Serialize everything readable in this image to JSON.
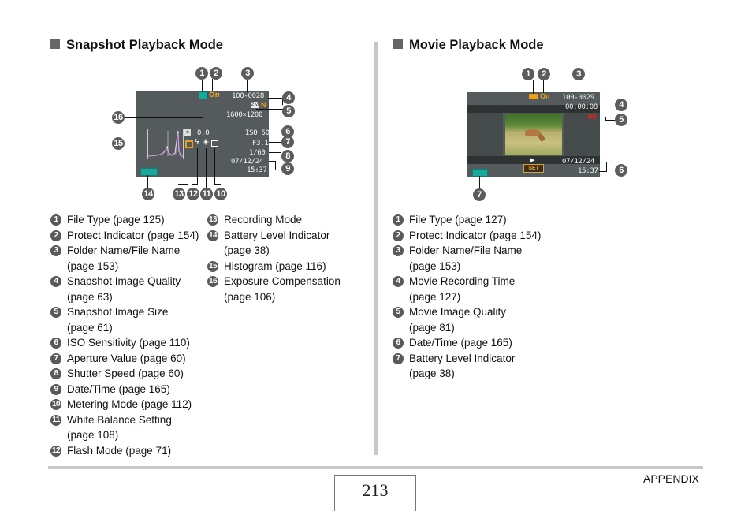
{
  "snapshot": {
    "title": "Snapshot Playback Mode",
    "screen": {
      "folder_file": "100-0028",
      "quality_icon": "N",
      "size_icon": "2M",
      "image_size": "1600×1200",
      "exposure_comp": "0.0",
      "iso": "ISO 50",
      "aperture": "F3.1",
      "shutter": "1/60",
      "date": "07/12/24",
      "time": "15:37"
    },
    "callouts": [
      "1",
      "2",
      "3",
      "4",
      "5",
      "6",
      "7",
      "8",
      "9",
      "10",
      "11",
      "12",
      "13",
      "14",
      "15",
      "16"
    ],
    "items_col1": [
      {
        "num": "1",
        "lines": [
          "File Type (page 125)"
        ]
      },
      {
        "num": "2",
        "lines": [
          "Protect Indicator (page 154)"
        ]
      },
      {
        "num": "3",
        "lines": [
          "Folder Name/File Name",
          "(page 153)"
        ]
      },
      {
        "num": "4",
        "lines": [
          "Snapshot Image Quality",
          "(page 63)"
        ]
      },
      {
        "num": "5",
        "lines": [
          "Snapshot Image Size",
          "(page 61)"
        ]
      },
      {
        "num": "6",
        "lines": [
          "ISO Sensitivity (page 110)"
        ]
      },
      {
        "num": "7",
        "lines": [
          "Aperture Value (page 60)"
        ]
      },
      {
        "num": "8",
        "lines": [
          "Shutter Speed (page 60)"
        ]
      },
      {
        "num": "9",
        "lines": [
          "Date/Time (page 165)"
        ]
      },
      {
        "num": "10",
        "lines": [
          "Metering Mode (page 112)"
        ]
      },
      {
        "num": "11",
        "lines": [
          "White Balance Setting",
          "(page 108)"
        ]
      },
      {
        "num": "12",
        "lines": [
          "Flash Mode (page 71)"
        ]
      }
    ],
    "items_col2": [
      {
        "num": "13",
        "lines": [
          "Recording Mode"
        ]
      },
      {
        "num": "14",
        "lines": [
          "Battery Level Indicator",
          "(page 38)"
        ]
      },
      {
        "num": "15",
        "lines": [
          "Histogram (page 116)"
        ]
      },
      {
        "num": "16",
        "lines": [
          "Exposure Compensation",
          "(page 106)"
        ]
      }
    ]
  },
  "movie": {
    "title": "Movie Playback Mode",
    "screen": {
      "folder_file": "100-0029",
      "recording_time": "00:00:08",
      "quality": "HQ",
      "set_label": "SET",
      "play_icon": "▶",
      "date": "07/12/24",
      "time": "15:37"
    },
    "callouts": [
      "1",
      "2",
      "3",
      "4",
      "5",
      "6",
      "7"
    ],
    "items": [
      {
        "num": "1",
        "lines": [
          "File Type (page 127)"
        ]
      },
      {
        "num": "2",
        "lines": [
          "Protect Indicator (page 154)"
        ]
      },
      {
        "num": "3",
        "lines": [
          "Folder Name/File Name",
          "(page 153)"
        ]
      },
      {
        "num": "4",
        "lines": [
          "Movie Recording Time",
          "(page 127)"
        ]
      },
      {
        "num": "5",
        "lines": [
          "Movie Image Quality",
          "(page 81)"
        ]
      },
      {
        "num": "6",
        "lines": [
          "Date/Time (page 165)"
        ]
      },
      {
        "num": "7",
        "lines": [
          "Battery Level Indicator",
          "(page 38)"
        ]
      }
    ]
  },
  "footer": {
    "page_number": "213",
    "section": "APPENDIX"
  },
  "colors": {
    "screen_bg": "#555b5c",
    "icon_orange": "#e8a020",
    "icon_teal": "#1aa89a",
    "hq_red": "#e02020",
    "bubble": "#5c5c5c",
    "rule": "#c8c8c8"
  }
}
